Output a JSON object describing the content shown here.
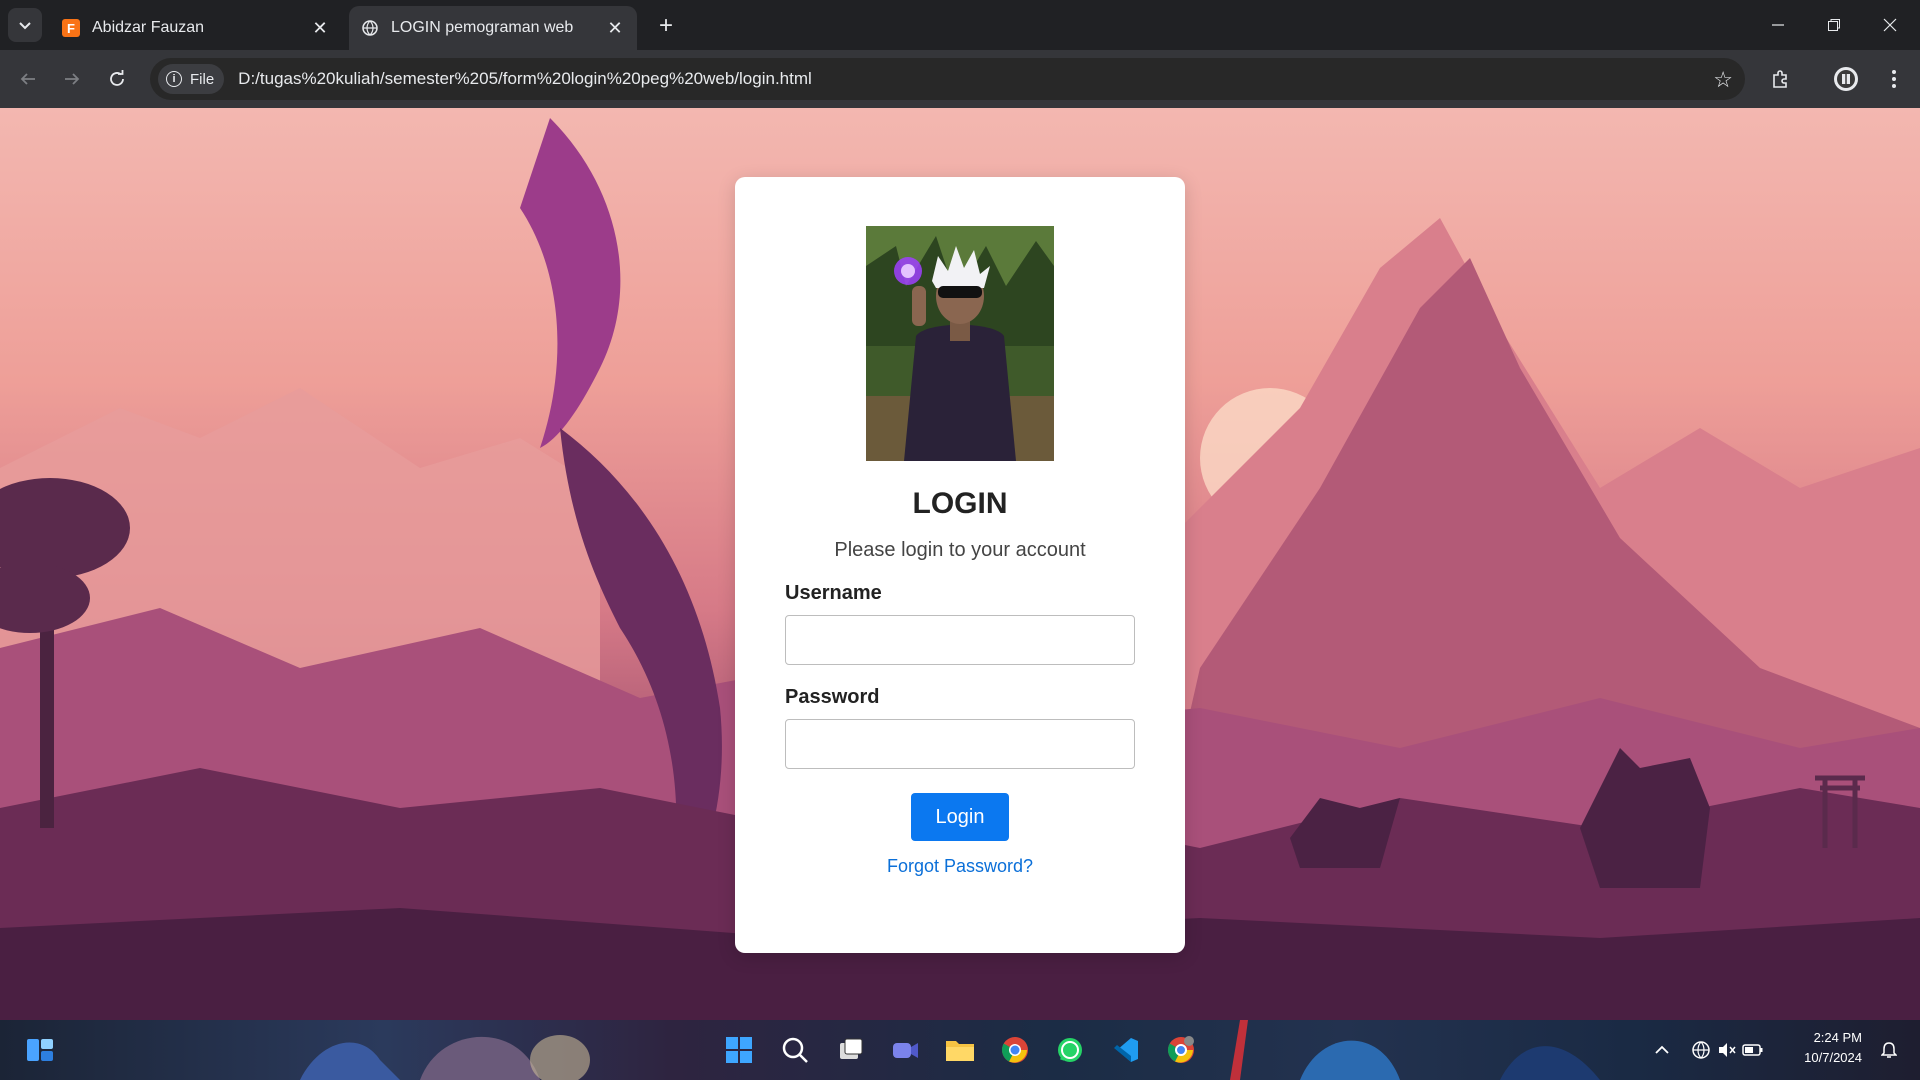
{
  "browser": {
    "tabs": [
      {
        "title": "Abidzar Fauzan",
        "favicon": "F"
      },
      {
        "title": "LOGIN pemograman web"
      }
    ],
    "address_chip": "File",
    "url": "D:/tugas%20kuliah/semester%205/form%20login%20peg%20web/login.html"
  },
  "login": {
    "title": "LOGIN",
    "subtitle": "Please login to your account",
    "username_label": "Username",
    "username_value": "",
    "password_label": "Password",
    "password_value": "",
    "button_label": "Login",
    "forgot_link": "Forgot Password?"
  },
  "taskbar": {
    "time": "2:24 PM",
    "date": "10/7/2024"
  },
  "colors": {
    "accent": "#0b78f0",
    "link": "#0b6fd8",
    "chrome_dark": "#202124"
  }
}
